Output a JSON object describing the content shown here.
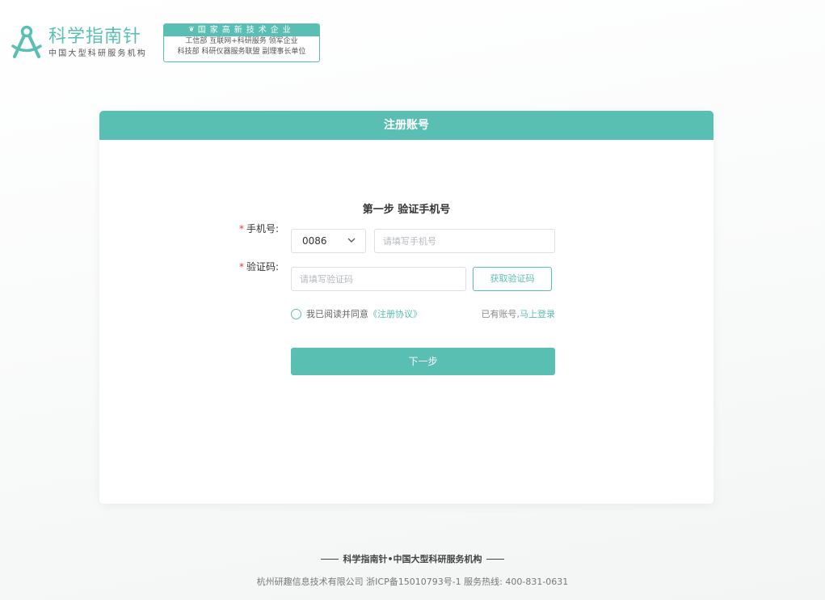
{
  "brand": {
    "title": "科学指南针",
    "subtitle": "中国大型科研服务机构"
  },
  "badge": {
    "top": "国家高新技术企业",
    "line1": "工信部 互联网+科研服务 领军企业",
    "line2": "科技部 科研仪器服务联盟 副理事长单位"
  },
  "card": {
    "title": "注册账号",
    "step_title": "第一步 验证手机号"
  },
  "form": {
    "phone_label": "手机号:",
    "country_code": "0086",
    "phone_placeholder": "请填写手机号",
    "code_label": "验证码:",
    "code_placeholder": "请填写验证码",
    "get_code_label": "获取验证码",
    "agree_text": "我已阅读并同意",
    "agree_link": "《注册协议》",
    "has_account": "已有账号,",
    "login_link": "马上登录",
    "next_label": "下一步"
  },
  "footer": {
    "title": "科学指南针•中国大型科研服务机构",
    "info": "杭州研趣信息技术有限公司 浙ICP备15010793号-1 服务热线: 400-831-0631"
  },
  "colors": {
    "accent": "#5abfb3",
    "required": "#e4393c"
  }
}
